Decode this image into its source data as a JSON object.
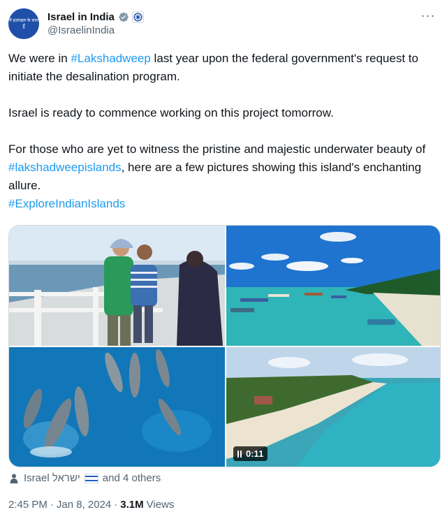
{
  "author": {
    "display_name": "Israel in India",
    "handle": "@IsraelinIndia",
    "avatar_text": "मैं इज़राइल के साथ हूँ"
  },
  "tweet": {
    "para1_prefix": "We were in ",
    "para1_hashtag": "#Lakshadweep",
    "para1_suffix": " last year upon the federal government's request to initiate the desalination program.",
    "para2": "Israel is ready to commence working on this project tomorrow.",
    "para3_prefix": "For those who are yet to witness the pristine and majestic underwater beauty of ",
    "para3_hashtag": "#lakshadweepislands",
    "para3_suffix": ", here are a few pictures showing this island's enchanting allure.",
    "hashtag_last": "#ExploreIndianIslands"
  },
  "media": {
    "video_duration": "0:11"
  },
  "tagged": {
    "label": "Israel ישראל",
    "others": "and 4 others"
  },
  "meta": {
    "time": "2:45 PM",
    "date": "Jan 8, 2024",
    "views_count": "3.1M",
    "views_label": "Views",
    "separator": "·"
  },
  "icons": [
    "verified-badge-icon",
    "government-affiliation-icon",
    "more-icon",
    "person-icon",
    "israel-flag-icon",
    "pause-icon"
  ],
  "colors": {
    "link": "#1d9bf0",
    "text": "#0f1419",
    "secondary": "#536471"
  }
}
